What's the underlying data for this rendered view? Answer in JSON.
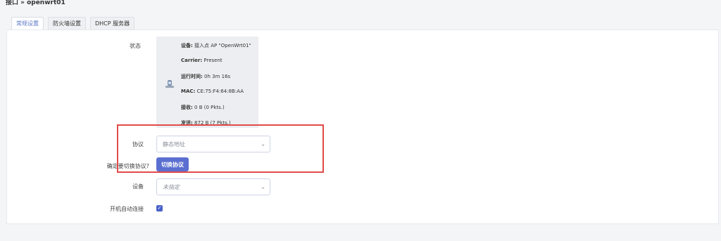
{
  "breadcrumb": "接口 » openwrt01",
  "tabs": [
    {
      "label": "常规设置"
    },
    {
      "label": "防火墙设置"
    },
    {
      "label": "DHCP 服务器"
    }
  ],
  "status": {
    "label": "状态",
    "device_key": "设备:",
    "device_val": " 接入点 AP \"OpenWrt01\"",
    "carrier_key": "Carrier:",
    "carrier_val": " Present",
    "uptime_key": "运行时间:",
    "uptime_val": " 0h 3m 16s",
    "mac_key": "MAC:",
    "mac_val": " CE:75:F4:64:8B:AA",
    "rx_key": "接收:",
    "rx_val": " 0 B (0 Pkts.)",
    "tx_key": "发送:",
    "tx_val": " 872 B (7 Pkts.)"
  },
  "protocol": {
    "label": "协议",
    "value": "静态地址"
  },
  "switch_protocol": {
    "label": "确定要切换协议?",
    "button": "切换协议"
  },
  "device": {
    "label": "设备",
    "value": "未指定"
  },
  "autostart": {
    "label": "开机自动连接",
    "checked": true
  }
}
